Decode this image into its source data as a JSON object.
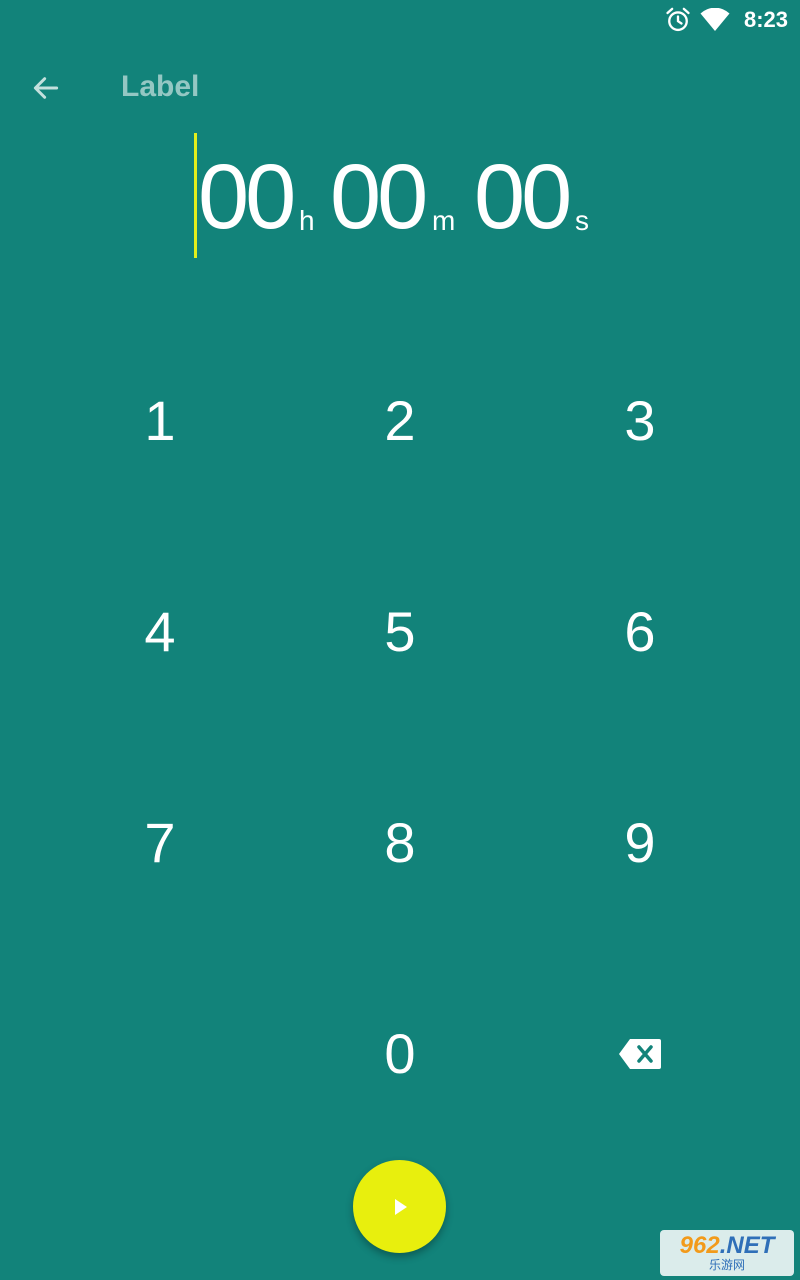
{
  "status_bar": {
    "time": "8:23",
    "icons": [
      "alarm-icon",
      "wifi-icon"
    ]
  },
  "header": {
    "back_icon": "arrow-left-icon",
    "label_placeholder": "Label"
  },
  "timer_display": {
    "hours": "00",
    "hours_unit": "h",
    "minutes": "00",
    "minutes_unit": "m",
    "seconds": "00",
    "seconds_unit": "s"
  },
  "keypad": {
    "keys": [
      "1",
      "2",
      "3",
      "4",
      "5",
      "6",
      "7",
      "8",
      "9",
      "",
      "0"
    ],
    "delete_icon": "backspace-icon"
  },
  "start_button": {
    "icon": "play-icon"
  },
  "watermark": {
    "brand_number": "962",
    "brand_suffix": ".NET",
    "brand_chinese": "乐游网"
  },
  "colors": {
    "background": "#12837a",
    "accent": "#e8ef0d",
    "cursor": "#e2ef1d"
  }
}
